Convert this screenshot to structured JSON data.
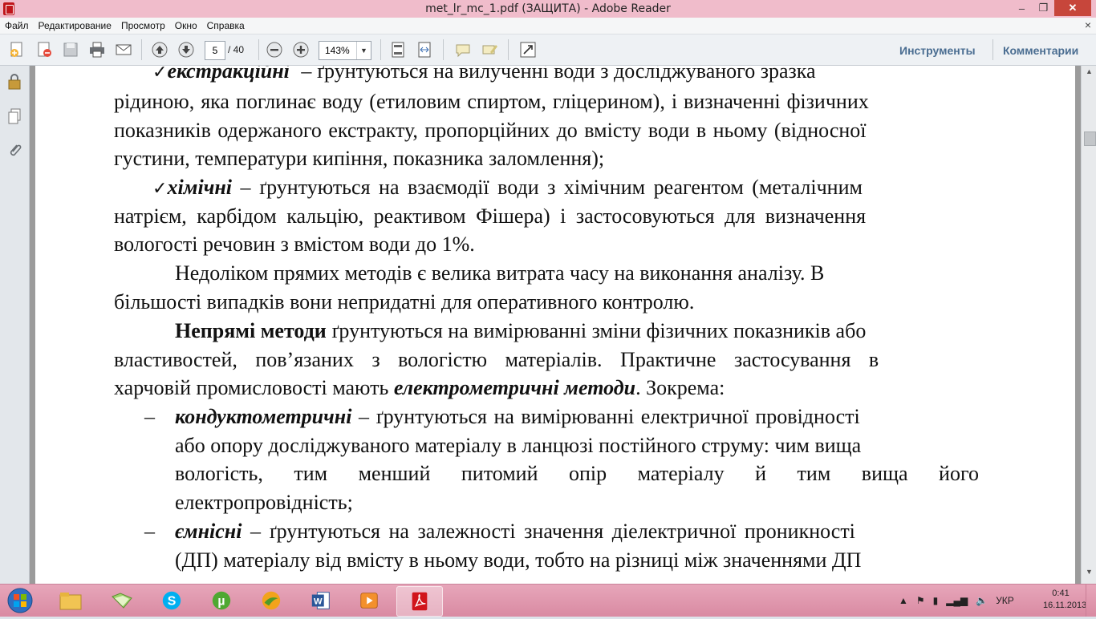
{
  "window": {
    "title": "met_lr_mc_1.pdf (ЗАЩИТА) - Adobe Reader",
    "min": "–",
    "max": "❐",
    "close": "✕"
  },
  "menu": [
    "Файл",
    "Редактирование",
    "Просмотр",
    "Окно",
    "Справка"
  ],
  "menu_close": "×",
  "toolbar": {
    "page_current": "5",
    "page_total": "/ 40",
    "zoom": "143%",
    "tools_label": "Инструменты",
    "comments_label": "Комментарии"
  },
  "document": {
    "lines": [
      [
        "✓ ",
        "екстракційні",
        " – ґрунтуються на вилученні води з досліджуваного зразка"
      ],
      "рідиною, яка поглинає воду (етиловим спиртом, гліцерином), і визначенні фізичних",
      "показників одержаного екстракту, пропорційних до вмісту води в ньому (відносної",
      "густини, температури кипіння, показника заломлення);",
      [
        "✓ ",
        "хімічні",
        " – ґрунтуються на взаємодії води з хімічним реагентом (металічним"
      ],
      "натрієм, карбідом кальцію, реактивом Фішера) і застосовуються для визначення",
      "вологості речовин з вмістом води до 1%.",
      "Недоліком прямих методів є велика витрата часу на виконання аналізу. В",
      "більшості випадків вони непридатні для оперативного контролю.",
      [
        "Непрямі методи",
        " ґрунтуються на вимірюванні зміни фізичних показників або"
      ],
      "властивостей, пов’язаних з вологістю матеріалів. Практичне застосування в",
      [
        "харчовій промисловості мають ",
        "електрометричні методи",
        ". Зокрема:"
      ],
      [
        "–",
        "кондуктометричні",
        " – ґрунтуються на вимірюванні електричної провідності"
      ],
      "або опору досліджуваного матеріалу в ланцюзі постійного струму: чим вища",
      "вологість, тим менший питомий опір матеріалу й тим вища його",
      "електропровідність;",
      [
        "–",
        "ємнісні",
        " – ґрунтуються на залежності значення діелектричної проникності"
      ],
      "(ДП) матеріалу від вмісту в ньому води, тобто на різниці між значеннями ДП"
    ]
  },
  "tray": {
    "lang": "УКР",
    "time": "0:41",
    "date": "16.11.2013"
  },
  "colors": {
    "titlebar": "#f0bccb",
    "taskbar": "#e0a0b4",
    "link": "#4a6d91",
    "close": "#c7463b"
  }
}
